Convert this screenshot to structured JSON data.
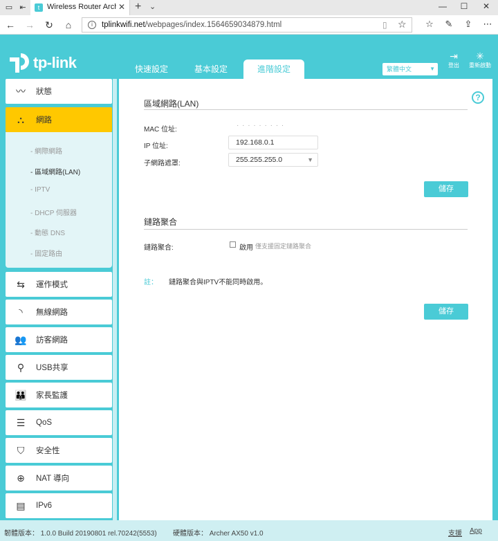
{
  "browser": {
    "tab_title": "Wireless Router Archer",
    "url_host": "tplinkwifi.net",
    "url_path": "/webpages/index.1564659034879.html"
  },
  "header": {
    "brand": "tp-link",
    "tabs": [
      {
        "label": "快速設定"
      },
      {
        "label": "基本設定"
      },
      {
        "label": "進階設定"
      }
    ],
    "language": "繁體中文",
    "logout_label": "登出",
    "reboot_label": "重新啟動"
  },
  "sidebar": {
    "items": [
      {
        "label": "狀態",
        "icon": "pulse-icon"
      },
      {
        "label": "網路",
        "icon": "network-icon"
      },
      {
        "label": "運作模式",
        "icon": "mode-icon"
      },
      {
        "label": "無線網路",
        "icon": "wifi-icon"
      },
      {
        "label": "訪客網路",
        "icon": "guest-icon"
      },
      {
        "label": "USB共享",
        "icon": "usb-icon"
      },
      {
        "label": "家長監護",
        "icon": "parental-icon"
      },
      {
        "label": "QoS",
        "icon": "qos-icon"
      },
      {
        "label": "安全性",
        "icon": "shield-icon"
      },
      {
        "label": "NAT 導向",
        "icon": "nat-icon"
      },
      {
        "label": "IPv6",
        "icon": "ipv6-icon"
      }
    ],
    "submenu": [
      {
        "label": "- 網際網路"
      },
      {
        "label": "- 區域網路(LAN)"
      },
      {
        "label": "- IPTV"
      },
      {
        "label": "- DHCP 伺服器"
      },
      {
        "label": "- 動態 DNS"
      },
      {
        "label": "- 固定路由"
      }
    ]
  },
  "lan": {
    "title": "區域網路(LAN)",
    "mac_label": "MAC 位址:",
    "mac_value": "· · · · · · · · ·",
    "ip_label": "IP 位址:",
    "ip_value": "192.168.0.1",
    "mask_label": "子網路遮罩:",
    "mask_value": "255.255.255.0",
    "save_label": "儲存"
  },
  "aggregation": {
    "title": "鏈路聚合",
    "label": "鏈路聚合:",
    "checkbox_label": "啟用",
    "hint": "僅支援固定鏈路聚合",
    "note_label": "註：",
    "note_text": "鏈路聚合與IPTV不能同時啟用。",
    "save_label": "儲存"
  },
  "footer": {
    "firmware": "韌體版本： 1.0.0 Build 20190801 rel.70242(5553)",
    "hardware": "硬體版本： Archer AX50 v1.0",
    "support": "支援",
    "app": "App"
  },
  "colors": {
    "accent": "#4acbd6",
    "active": "#ffc800"
  }
}
